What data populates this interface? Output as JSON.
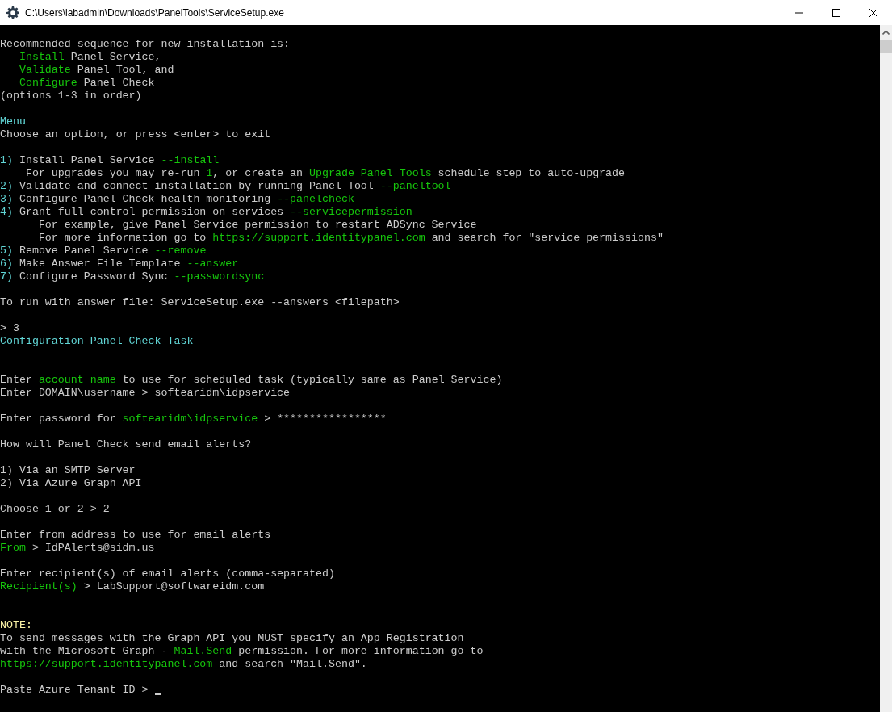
{
  "window": {
    "title": "C:\\Users\\labadmin\\Downloads\\PanelTools\\ServiceSetup.exe"
  },
  "console": {
    "lines": [
      {
        "kind": "blank"
      },
      {
        "kind": "text",
        "segments": [
          {
            "text": "Recommended sequence for new installation is:"
          }
        ]
      },
      {
        "kind": "text",
        "segments": [
          {
            "text": "   Install",
            "color": "#16c60c"
          },
          {
            "text": " Panel Service,"
          }
        ]
      },
      {
        "kind": "text",
        "segments": [
          {
            "text": "   Validate",
            "color": "#16c60c"
          },
          {
            "text": " Panel Tool, and"
          }
        ]
      },
      {
        "kind": "text",
        "segments": [
          {
            "text": "   Configure",
            "color": "#16c60c"
          },
          {
            "text": " Panel Check"
          }
        ]
      },
      {
        "kind": "text",
        "segments": [
          {
            "text": "(options 1-3 in order)"
          }
        ]
      },
      {
        "kind": "blank"
      },
      {
        "kind": "text",
        "segments": [
          {
            "text": "Menu",
            "color": "#61d6d6"
          }
        ]
      },
      {
        "kind": "text",
        "segments": [
          {
            "text": "Choose an option, or press <enter> to exit"
          }
        ]
      },
      {
        "kind": "blank"
      },
      {
        "kind": "text",
        "segments": [
          {
            "text": "1)",
            "color": "#61d6d6"
          },
          {
            "text": " Install Panel Service "
          },
          {
            "text": "--install",
            "color": "#16c60c"
          }
        ]
      },
      {
        "kind": "text",
        "segments": [
          {
            "text": "    For upgrades you may re-run "
          },
          {
            "text": "1",
            "color": "#16c60c"
          },
          {
            "text": ", or create an "
          },
          {
            "text": "Upgrade Panel Tools",
            "color": "#16c60c"
          },
          {
            "text": " schedule step to auto-upgrade"
          }
        ]
      },
      {
        "kind": "text",
        "segments": [
          {
            "text": "2)",
            "color": "#61d6d6"
          },
          {
            "text": " Validate and connect installation by running Panel Tool "
          },
          {
            "text": "--paneltool",
            "color": "#16c60c"
          }
        ]
      },
      {
        "kind": "text",
        "segments": [
          {
            "text": "3)",
            "color": "#61d6d6"
          },
          {
            "text": " Configure Panel Check health monitoring "
          },
          {
            "text": "--panelcheck",
            "color": "#16c60c"
          }
        ]
      },
      {
        "kind": "text",
        "segments": [
          {
            "text": "4)",
            "color": "#61d6d6"
          },
          {
            "text": " Grant full control permission on services "
          },
          {
            "text": "--servicepermission",
            "color": "#16c60c"
          }
        ]
      },
      {
        "kind": "text",
        "segments": [
          {
            "text": "      For example, give Panel Service permission to restart ADSync Service"
          }
        ]
      },
      {
        "kind": "text",
        "segments": [
          {
            "text": "      For more information go to "
          },
          {
            "text": "https://support.identitypanel.com",
            "color": "#16c60c"
          },
          {
            "text": " and search for \"service permissions\""
          }
        ]
      },
      {
        "kind": "text",
        "segments": [
          {
            "text": "5)",
            "color": "#61d6d6"
          },
          {
            "text": " Remove Panel Service "
          },
          {
            "text": "--remove",
            "color": "#16c60c"
          }
        ]
      },
      {
        "kind": "text",
        "segments": [
          {
            "text": "6)",
            "color": "#61d6d6"
          },
          {
            "text": " Make Answer File Template "
          },
          {
            "text": "--answer",
            "color": "#16c60c"
          }
        ]
      },
      {
        "kind": "text",
        "segments": [
          {
            "text": "7)",
            "color": "#61d6d6"
          },
          {
            "text": " Configure Password Sync "
          },
          {
            "text": "--passwordsync",
            "color": "#16c60c"
          }
        ]
      },
      {
        "kind": "blank"
      },
      {
        "kind": "text",
        "segments": [
          {
            "text": "To run with answer file: ServiceSetup.exe --answers <filepath>"
          }
        ]
      },
      {
        "kind": "blank"
      },
      {
        "kind": "text",
        "segments": [
          {
            "text": "> 3"
          }
        ]
      },
      {
        "kind": "text",
        "segments": [
          {
            "text": "Configuration Panel Check Task",
            "color": "#61d6d6"
          }
        ]
      },
      {
        "kind": "blank"
      },
      {
        "kind": "blank"
      },
      {
        "kind": "text",
        "segments": [
          {
            "text": "Enter "
          },
          {
            "text": "account name",
            "color": "#16c60c"
          },
          {
            "text": " to use for scheduled task (typically same as Panel Service)"
          }
        ]
      },
      {
        "kind": "text",
        "segments": [
          {
            "text": "Enter DOMAIN\\username > softearidm\\idpservice"
          }
        ]
      },
      {
        "kind": "blank"
      },
      {
        "kind": "text",
        "segments": [
          {
            "text": "Enter password for "
          },
          {
            "text": "softearidm\\idpservice",
            "color": "#16c60c"
          },
          {
            "text": " > *****************"
          }
        ]
      },
      {
        "kind": "blank"
      },
      {
        "kind": "text",
        "segments": [
          {
            "text": "How will Panel Check send email alerts?"
          }
        ]
      },
      {
        "kind": "blank"
      },
      {
        "kind": "text",
        "segments": [
          {
            "text": "1) Via an SMTP Server"
          }
        ]
      },
      {
        "kind": "text",
        "segments": [
          {
            "text": "2) Via Azure Graph API"
          }
        ]
      },
      {
        "kind": "blank"
      },
      {
        "kind": "text",
        "segments": [
          {
            "text": "Choose 1 or 2 > 2"
          }
        ]
      },
      {
        "kind": "blank"
      },
      {
        "kind": "text",
        "segments": [
          {
            "text": "Enter from address to use for email alerts"
          }
        ]
      },
      {
        "kind": "text",
        "segments": [
          {
            "text": "From",
            "color": "#16c60c"
          },
          {
            "text": " > IdPAlerts@sidm.us"
          }
        ]
      },
      {
        "kind": "blank"
      },
      {
        "kind": "text",
        "segments": [
          {
            "text": "Enter recipient(s) of email alerts (comma-separated)"
          }
        ]
      },
      {
        "kind": "text",
        "segments": [
          {
            "text": "Recipient(s)",
            "color": "#16c60c"
          },
          {
            "text": " > LabSupport@softwareidm.com"
          }
        ]
      },
      {
        "kind": "blank"
      },
      {
        "kind": "blank"
      },
      {
        "kind": "text",
        "segments": [
          {
            "text": "NOTE:",
            "color": "#f9f1a5"
          }
        ]
      },
      {
        "kind": "text",
        "segments": [
          {
            "text": "To send messages with the Graph API you MUST specify an App Registration"
          }
        ]
      },
      {
        "kind": "text",
        "segments": [
          {
            "text": "with the Microsoft Graph - "
          },
          {
            "text": "Mail.Send",
            "color": "#16c60c"
          },
          {
            "text": " permission. For more information go to"
          }
        ]
      },
      {
        "kind": "text",
        "segments": [
          {
            "text": "https://support.identitypanel.com",
            "color": "#16c60c"
          },
          {
            "text": " and search \"Mail.Send\"."
          }
        ]
      },
      {
        "kind": "blank"
      },
      {
        "kind": "text",
        "cursor": true,
        "segments": [
          {
            "text": "Paste Azure Tenant ID > "
          }
        ]
      }
    ]
  }
}
